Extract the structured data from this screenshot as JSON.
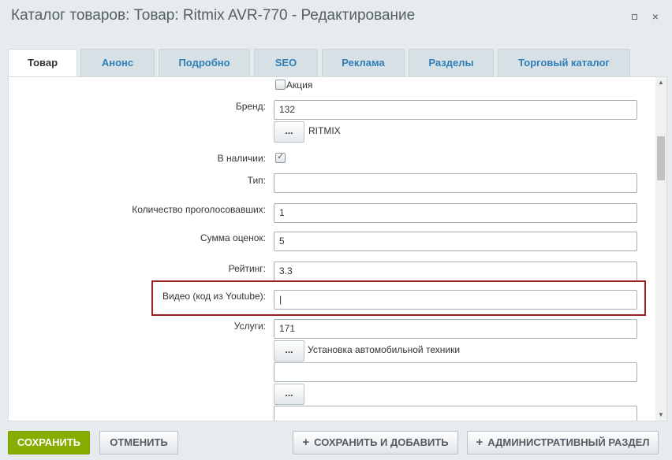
{
  "window": {
    "title": "Каталог товаров: Товар: Ritmix AVR-770 - Редактирование",
    "maximize_icon": "maximize-icon",
    "close_icon": "×"
  },
  "tabs": [
    {
      "label": "Товар",
      "active": true
    },
    {
      "label": "Анонс",
      "active": false
    },
    {
      "label": "Подробно",
      "active": false
    },
    {
      "label": "SEO",
      "active": false
    },
    {
      "label": "Реклама",
      "active": false
    },
    {
      "label": "Разделы",
      "active": false
    },
    {
      "label": "Торговый каталог",
      "active": false
    }
  ],
  "form": {
    "action_checkbox_label": "Акция",
    "brand": {
      "label": "Бренд:",
      "value": "132",
      "button": "...",
      "linked_name": "RITMIX"
    },
    "in_stock": {
      "label": "В наличии:",
      "checked": true,
      "tick": "✓"
    },
    "type": {
      "label": "Тип:",
      "value": ""
    },
    "votes_count": {
      "label": "Количество проголосовавших:",
      "value": "1"
    },
    "votes_sum": {
      "label": "Сумма оценок:",
      "value": "5"
    },
    "rating": {
      "label": "Рейтинг:",
      "value": "3.3"
    },
    "video": {
      "label": "Видео (код из Youtube):",
      "value": "|"
    },
    "services": {
      "label": "Услуги:",
      "value": "171",
      "button": "...",
      "linked_name": "Установка автомобильной техники",
      "value2": "",
      "button2": "...",
      "value3": ""
    }
  },
  "footer": {
    "save": "СОХРАНИТЬ",
    "cancel": "ОТМЕНИТЬ",
    "save_add": "СОХРАНИТЬ И ДОБАВИТЬ",
    "admin_section": "АДМИНИСТРАТИВНЫЙ РАЗДЕЛ",
    "plus": "+"
  },
  "colors": {
    "save_button": "#86ad00",
    "highlight_border": "#9a1e22",
    "tab_text": "#2f7fb8"
  }
}
